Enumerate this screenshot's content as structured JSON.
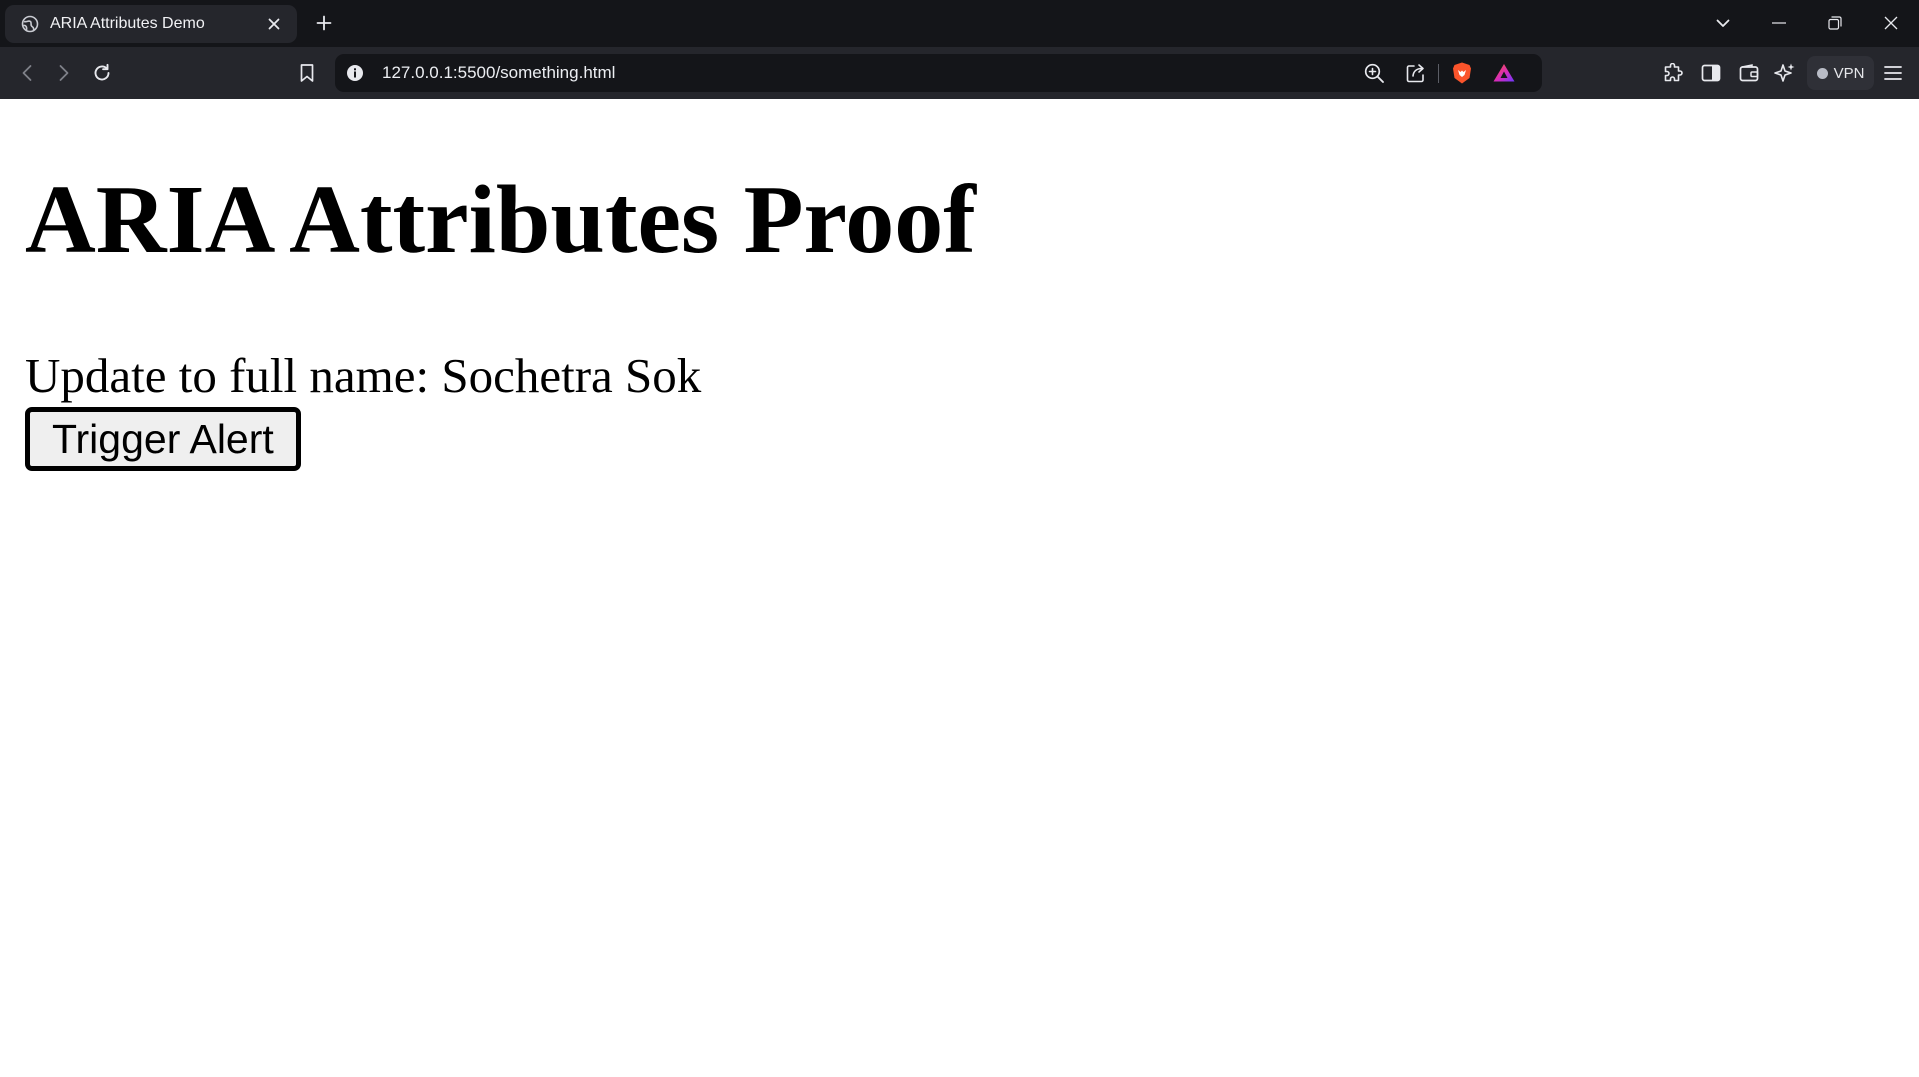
{
  "browser": {
    "tab": {
      "title": "ARIA Attributes Demo",
      "favicon": "globe-icon"
    },
    "address_bar": {
      "url": "127.0.0.1:5500/something.html"
    },
    "vpn_label": "VPN",
    "colors": {
      "tabstrip_bg": "#141519",
      "toolbar_bg": "#25262c",
      "brave_orange": "#fb542b",
      "rewards_purple": "#a13bff"
    }
  },
  "page": {
    "heading": "ARIA Attributes Proof",
    "status_text": "Update to full name: Sochetra Sok",
    "button_label": "Trigger Alert"
  }
}
